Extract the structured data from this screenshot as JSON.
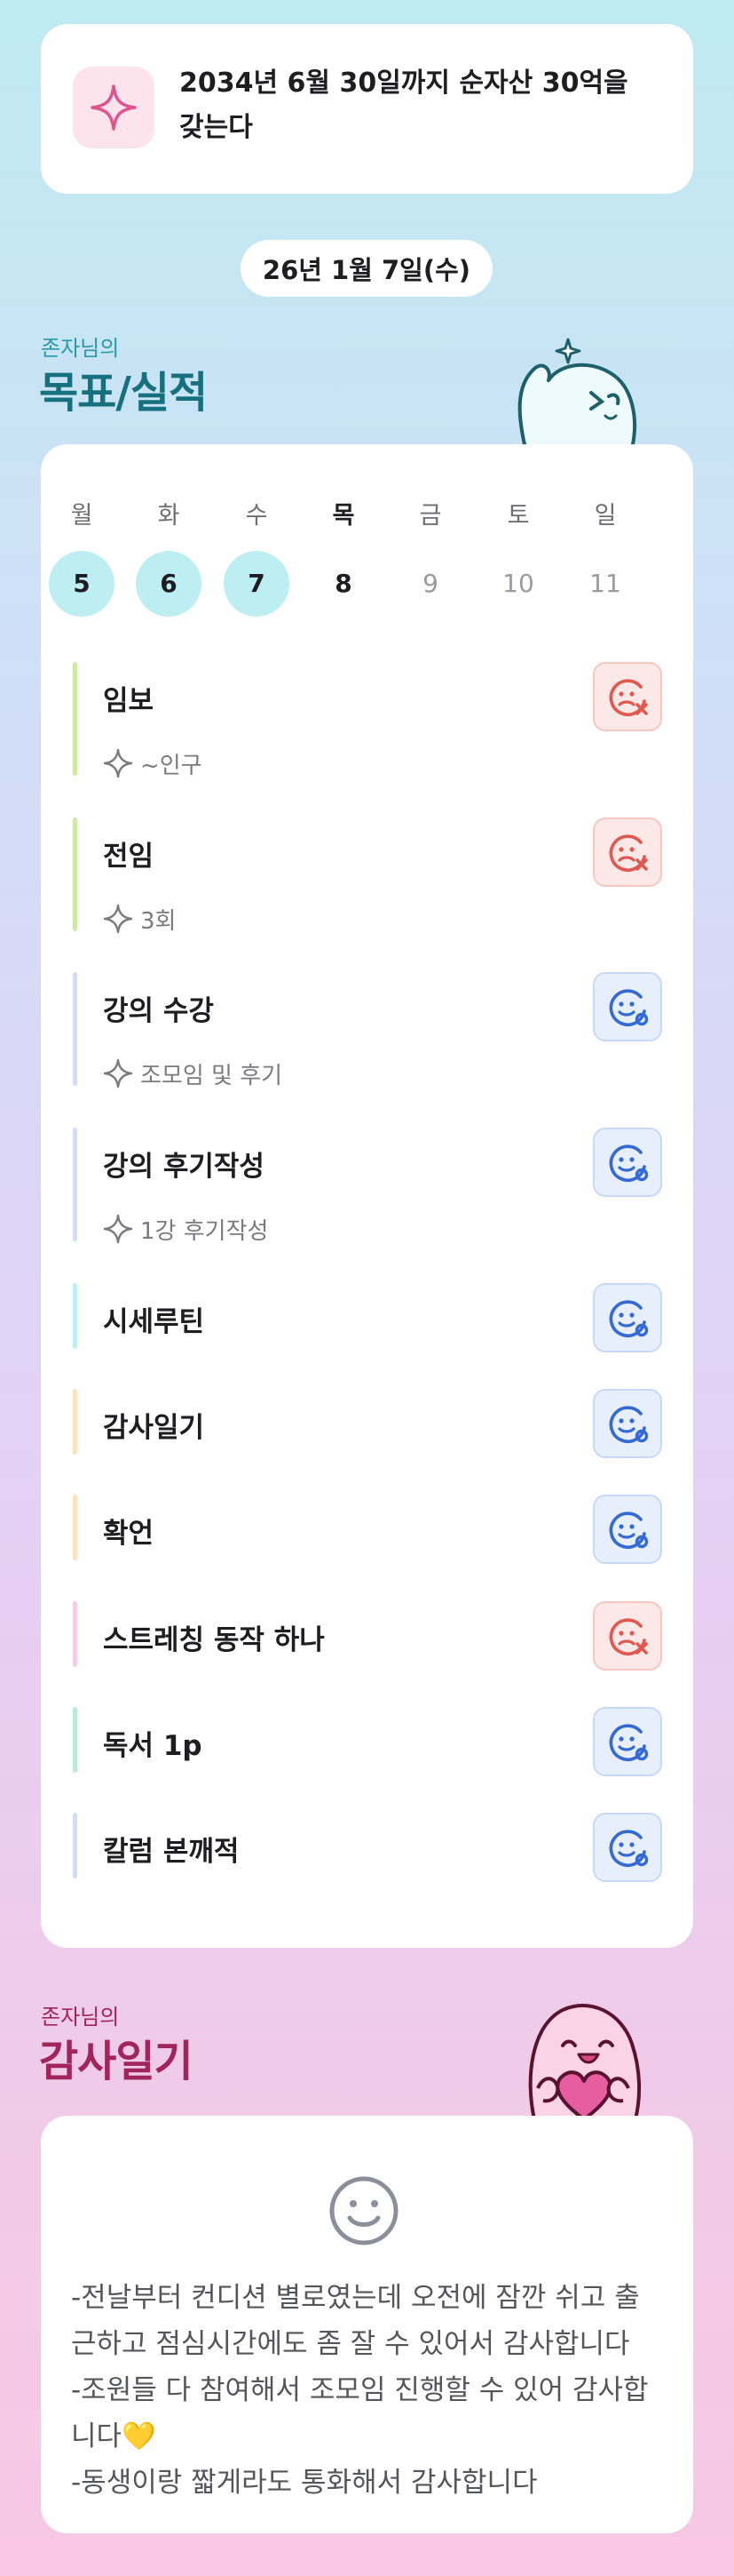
{
  "goal": {
    "icon": "sparkle-icon",
    "text": "2034년 6월 30일까지 순자산 30억을 갖는다"
  },
  "date": "26년 1월 7일(수)",
  "records_section": {
    "subtitle": "존자님의",
    "title": "목표/실적",
    "title_color": "#17707e",
    "mascot": "waving-ghost-mascot"
  },
  "week": {
    "day_names": [
      "월",
      "화",
      "수",
      "목",
      "금",
      "토",
      "일"
    ],
    "day_numbers": [
      "5",
      "6",
      "7",
      "8",
      "9",
      "10",
      "11"
    ],
    "today_index": 3,
    "filled_indices": [
      0,
      1,
      2
    ]
  },
  "habits": [
    {
      "name": "임보",
      "sub": "~인구",
      "status": "fail",
      "bar_color": "#cdeaa2"
    },
    {
      "name": "전임",
      "sub": "3회",
      "status": "fail",
      "bar_color": "#cdeaa2"
    },
    {
      "name": "강의 수강",
      "sub": "조모임 및 후기",
      "status": "done",
      "bar_color": "#d3dcf4"
    },
    {
      "name": "강의 후기작성",
      "sub": "1강 후기작성",
      "status": "done",
      "bar_color": "#d3dcf4"
    },
    {
      "name": "시세루틴",
      "status": "done",
      "bar_color": "#bdeef2"
    },
    {
      "name": "감사일기",
      "status": "done",
      "bar_color": "#fde3b8"
    },
    {
      "name": "확언",
      "status": "done",
      "bar_color": "#fde3b8"
    },
    {
      "name": "스트레칭 동작 하나",
      "status": "fail",
      "bar_color": "#f8cde4"
    },
    {
      "name": "독서 1p",
      "status": "done",
      "bar_color": "#b9ecd6"
    },
    {
      "name": "칼럼 본깨적",
      "status": "done",
      "bar_color": "#d3dcf4"
    }
  ],
  "gratitude_section": {
    "subtitle": "존자님의",
    "title": "감사일기",
    "title_color": "#a2245d",
    "mascot": "heart-holding-ghost-mascot"
  },
  "gratitude": {
    "mood_icon": "smile-icon",
    "lines": [
      "-전날부터 컨디션 별로였는데 오전에 잠깐 쉬고 출근하고 점심시간에도 좀 잘 수 있어서 감사합니다",
      "-조원들 다 참여해서 조모임 진행할 수 있어 감사합니다💛",
      "-동생이랑 짧게라도 통화해서 감사합니다"
    ]
  }
}
